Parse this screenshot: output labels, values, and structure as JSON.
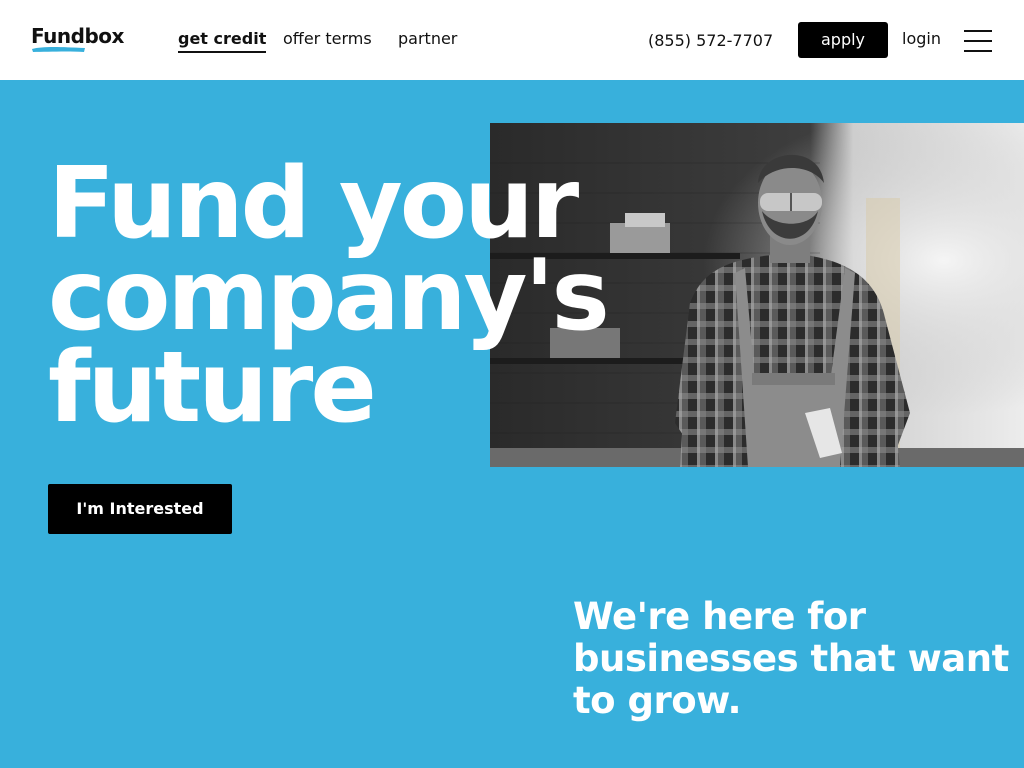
{
  "brand": {
    "logo_text": "Fundbox",
    "accent_color": "#38b0dc"
  },
  "nav": {
    "links": [
      {
        "label": "get credit",
        "active": true
      },
      {
        "label": "offer terms",
        "active": false
      },
      {
        "label": "partner",
        "active": false
      }
    ],
    "phone": "(855) 572-7707",
    "apply_label": "apply",
    "login_label": "login",
    "menu_icon": "hamburger-menu-icon"
  },
  "hero": {
    "title_lines": [
      "Fund your",
      "company's",
      "future"
    ],
    "cta_label": "I'm Interested",
    "image": "grayscale-photo-craftsman-in-apron-workshop"
  },
  "tagline": {
    "lines": [
      "We're here for",
      "businesses that want",
      "to grow."
    ]
  },
  "colors": {
    "hero_background": "#38b0dc",
    "button": "#000000",
    "header": "#ffffff"
  }
}
